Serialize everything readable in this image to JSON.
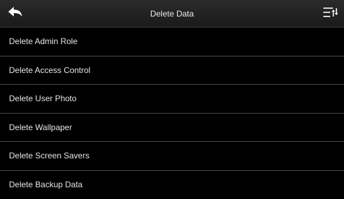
{
  "header": {
    "title": "Delete Data",
    "back_icon": "back-arrow-icon",
    "sort_icon": "sort-menu-icon"
  },
  "menu": {
    "items": [
      {
        "label": "Delete Admin Role"
      },
      {
        "label": "Delete Access Control"
      },
      {
        "label": "Delete User Photo"
      },
      {
        "label": "Delete Wallpaper"
      },
      {
        "label": "Delete Screen Savers"
      },
      {
        "label": "Delete Backup Data"
      }
    ]
  },
  "colors": {
    "background": "#000000",
    "header": "#222222",
    "divider": "#4a4a4a",
    "text": "#e6e6e6"
  }
}
